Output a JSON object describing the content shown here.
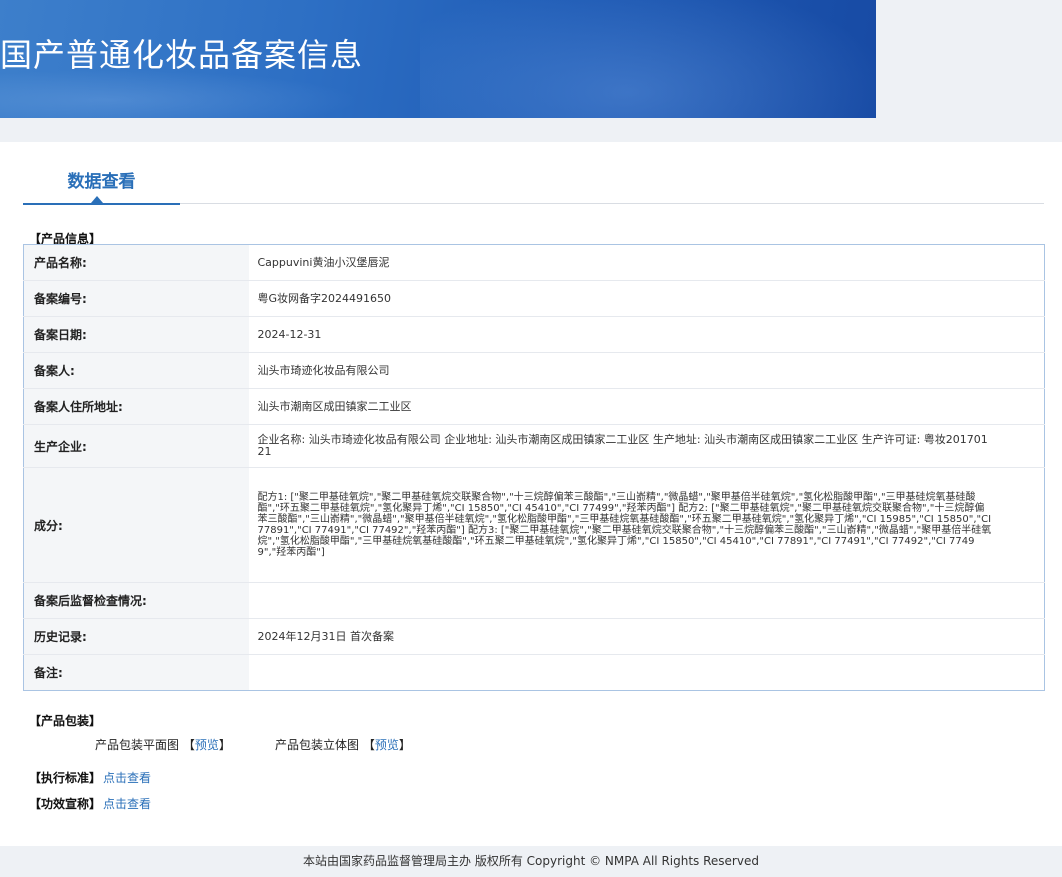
{
  "header": {
    "title": "国产普通化妆品备案信息"
  },
  "tabs": [
    {
      "label": "数据查看",
      "active": true
    }
  ],
  "product_info": {
    "section_label": "【产品信息】",
    "rows": [
      {
        "label": "产品名称:",
        "value": "Cappuvini黄油小汉堡唇泥"
      },
      {
        "label": "备案编号:",
        "value": "粤G妆网备字2024491650"
      },
      {
        "label": "备案日期:",
        "value": "2024-12-31"
      },
      {
        "label": "备案人:",
        "value": "汕头市琦迹化妆品有限公司"
      },
      {
        "label": "备案人住所地址:",
        "value": "汕头市潮南区成田镇家二工业区"
      },
      {
        "label": "生产企业:",
        "value": "企业名称: 汕头市琦迹化妆品有限公司 企业地址: 汕头市潮南区成田镇家二工业区 生产地址: 汕头市潮南区成田镇家二工业区 生产许可证: 粤妆20170121"
      },
      {
        "label": "成分:",
        "value": "配方1: [\"聚二甲基硅氧烷\",\"聚二甲基硅氧烷交联聚合物\",\"十三烷醇偏苯三酸酯\",\"三山嵛精\",\"微晶蜡\",\"聚甲基倍半硅氧烷\",\"氢化松脂酸甲酯\",\"三甲基硅烷氧基硅酸酯\",\"环五聚二甲基硅氧烷\",\"氢化聚异丁烯\",\"CI 15850\",\"CI 45410\",\"CI 77499\",\"羟苯丙酯\"] 配方2: [\"聚二甲基硅氧烷\",\"聚二甲基硅氧烷交联聚合物\",\"十三烷醇偏苯三酸酯\",\"三山嵛精\",\"微晶蜡\",\"聚甲基倍半硅氧烷\",\"氢化松脂酸甲酯\",\"三甲基硅烷氧基硅酸酯\",\"环五聚二甲基硅氧烷\",\"氢化聚异丁烯\",\"CI 15985\",\"CI 15850\",\"CI 77891\",\"CI 77491\",\"CI 77492\",\"羟苯丙酯\"] 配方3: [\"聚二甲基硅氧烷\",\"聚二甲基硅氧烷交联聚合物\",\"十三烷醇偏苯三酸酯\",\"三山嵛精\",\"微晶蜡\",\"聚甲基倍半硅氧烷\",\"氢化松脂酸甲酯\",\"三甲基硅烷氧基硅酸酯\",\"环五聚二甲基硅氧烷\",\"氢化聚异丁烯\",\"CI 15850\",\"CI 45410\",\"CI 77891\",\"CI 77491\",\"CI 77492\",\"CI 77499\",\"羟苯丙酯\"]"
      },
      {
        "label": "备案后监督检查情况:",
        "value": ""
      },
      {
        "label": "历史记录:",
        "value": "2024年12月31日 首次备案"
      },
      {
        "label": "备注:",
        "value": ""
      }
    ]
  },
  "packaging": {
    "section_label": "【产品包装】",
    "flat_label": "产品包装平面图",
    "flat_link": "预览",
    "solid_label": "产品包装立体图",
    "solid_link": "预览",
    "bracket_open": "【",
    "bracket_close": "】"
  },
  "standard": {
    "section_label": "【执行标准】",
    "link": "点击查看"
  },
  "claims": {
    "section_label": "【功效宣称】",
    "link": "点击查看"
  },
  "footer": {
    "text": "本站由国家药品监督管理局主办 版权所有 Copyright © NMPA All Rights Reserved"
  },
  "colors": {
    "accent": "#2a6fb8",
    "banner": "#2d6fc4",
    "table_border": "#aac4e3"
  }
}
